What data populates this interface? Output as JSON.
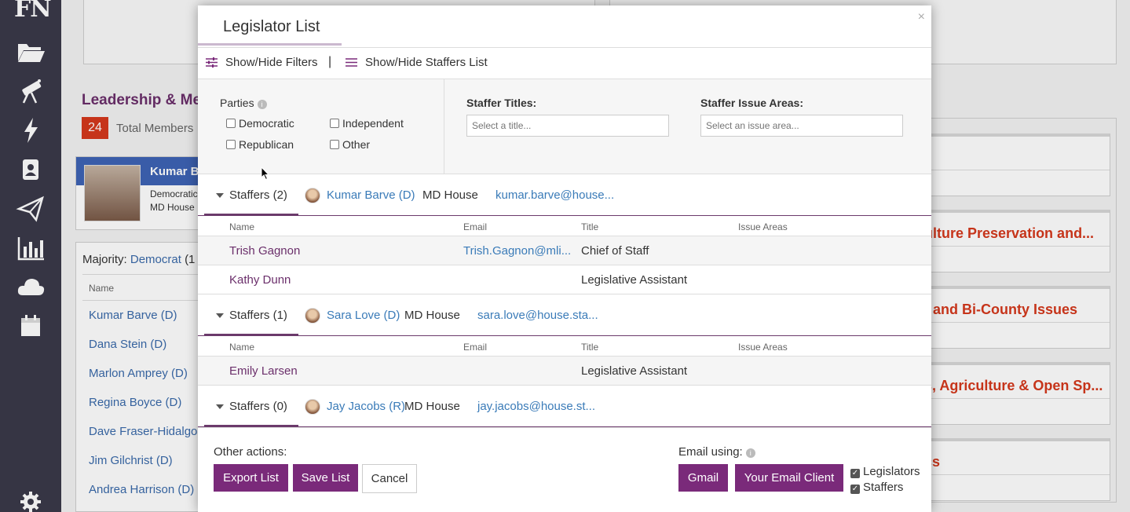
{
  "nav": {
    "logo": "FN",
    "icons": [
      "folder-icon",
      "telescope-icon",
      "lightning-icon",
      "contact-card-icon",
      "paper-plane-icon",
      "bar-chart-icon",
      "cloud-icon",
      "calendar-icon",
      "gear-icon"
    ]
  },
  "background": {
    "leadership_title": "Leadership & Me",
    "total_count": "24",
    "total_label": "Total Members",
    "card": {
      "name": "Kumar B",
      "party": "Democratic",
      "chamber": "MD House"
    },
    "majority_label": "Majority:",
    "majority_party": "Democrat",
    "majority_suffix": "(1",
    "name_header": "Name",
    "members": [
      "Kumar Barve (D)",
      "Dana Stein (D)",
      "Marlon Amprey (D)",
      "Regina Boyce (D)",
      "Dave Fraser-Hidalgo",
      "Jim Gilchrist (D)",
      "Andrea Harrison (D)"
    ],
    "right_titles": [
      "ulture Preservation and...",
      "t and Bi-County Issues",
      "s, Agriculture & Open Sp...",
      "cs"
    ]
  },
  "modal": {
    "title": "Legislator List",
    "close": "×",
    "toolbar": {
      "filters": "Show/Hide Filters",
      "separator": "|",
      "staffers": "Show/Hide Staffers List"
    },
    "filters": {
      "parties_label": "Parties",
      "info": "i",
      "parties": [
        "Democratic",
        "Independent",
        "Republican",
        "Other"
      ],
      "titles_label": "Staffer Titles:",
      "titles_placeholder": "Select a title...",
      "issues_label": "Staffer Issue Areas:",
      "issues_placeholder": "Select an issue area..."
    },
    "columns": [
      "Name",
      "Email",
      "Title",
      "Issue Areas"
    ],
    "groups": [
      {
        "staffers_label": "Staffers (2)",
        "legislator": "Kumar Barve (D)",
        "chamber": "MD House",
        "email": "kumar.barve@house...",
        "rows": [
          {
            "name": "Trish Gagnon",
            "email": "Trish.Gagnon@mli...",
            "title": "Chief of Staff"
          },
          {
            "name": "Kathy Dunn",
            "email": "",
            "title": "Legislative Assistant"
          }
        ]
      },
      {
        "staffers_label": "Staffers (1)",
        "legislator": "Sara Love (D)",
        "chamber": "MD House",
        "email": "sara.love@house.sta...",
        "rows": [
          {
            "name": "Emily Larsen",
            "email": "",
            "title": "Legislative Assistant"
          }
        ]
      },
      {
        "staffers_label": "Staffers (0)",
        "legislator": "Jay Jacobs (R)",
        "chamber": "MD House",
        "email": "jay.jacobs@house.st...",
        "rows": []
      }
    ],
    "footer": {
      "other_actions": "Other actions:",
      "export": "Export List",
      "save": "Save List",
      "cancel": "Cancel",
      "email_using": "Email using:",
      "gmail": "Gmail",
      "client": "Your Email Client",
      "legislators": "Legislators",
      "staffers": "Staffers"
    }
  },
  "colors": {
    "nav_bg": "#3b3a4a",
    "accent_purple": "#7a2a7a",
    "link_blue": "#3a7bb8",
    "staffer_name": "#6b2f6b",
    "alert_red": "#d5391c"
  }
}
